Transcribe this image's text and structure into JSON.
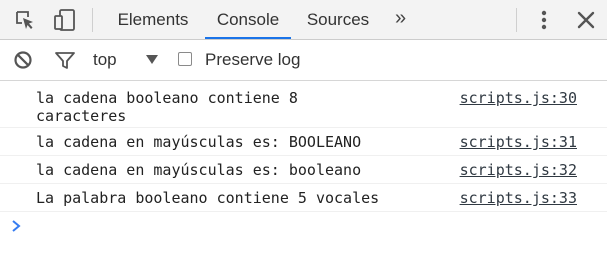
{
  "tabbar": {
    "icons": {
      "inspect": "inspect-element-icon",
      "device": "device-toolbar-icon",
      "more_tabs": "more-tabs-icon",
      "menu": "kebab-menu-icon",
      "close": "close-icon"
    },
    "tabs": [
      {
        "label": "Elements",
        "selected": false
      },
      {
        "label": "Console",
        "selected": true
      },
      {
        "label": "Sources",
        "selected": false
      }
    ],
    "more_label": "»"
  },
  "toolbar": {
    "clear_icon": "clear-console-icon",
    "filter_icon": "filter-icon",
    "context": "top",
    "preserve_log_label": "Preserve log",
    "preserve_log_checked": false
  },
  "messages": [
    {
      "text": "la cadena booleano contiene 8\ncaracteres",
      "source": "scripts.js:30"
    },
    {
      "text": "la cadena en mayúsculas es: BOOLEANO",
      "source": "scripts.js:31"
    },
    {
      "text": "la cadena en mayúsculas es: booleano",
      "source": "scripts.js:32"
    },
    {
      "text": "La palabra booleano contiene 5 vocales",
      "source": "scripts.js:33"
    }
  ],
  "prompt_icon": "console-prompt-chevron-icon",
  "colors": {
    "accent": "#1a73e8",
    "prompt": "#367cf1"
  }
}
